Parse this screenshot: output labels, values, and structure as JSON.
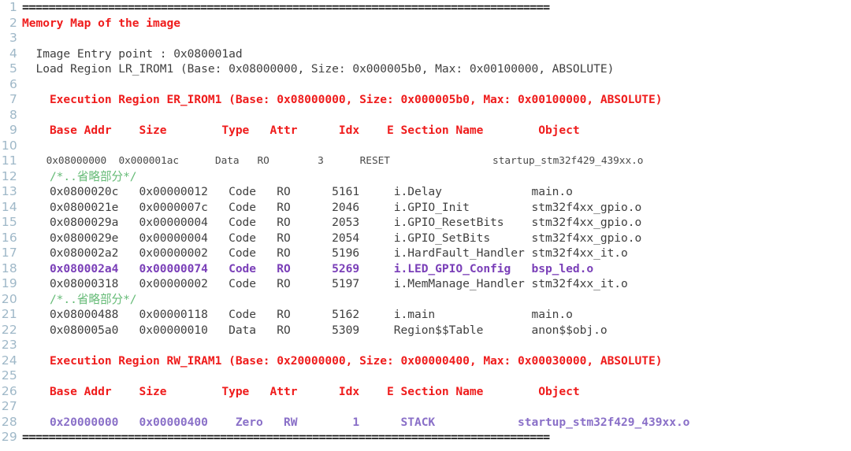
{
  "editor": {
    "title": "Memory Map of the image",
    "language": "armlink-map-listing",
    "gutter_color": "#9fb8c8",
    "colors": {
      "separator": "#1a1a1a",
      "heading_red": "#ef1c1c",
      "plain": "#404040",
      "comment_green": "#66bb77",
      "highlight_purple": "#7a3fb8",
      "highlight_purple_alt": "#8a70c8",
      "background": "#ffffff"
    },
    "first_line_number": 1,
    "last_line_number": 29,
    "total_lines": 29
  },
  "lines": [
    {
      "n": "1",
      "style": "c-sep",
      "text": "================================================================================"
    },
    {
      "n": "2",
      "style": "c-red",
      "text": "Memory Map of the image"
    },
    {
      "n": "3",
      "style": "c-plain",
      "text": ""
    },
    {
      "n": "4",
      "style": "c-plain",
      "text": "  Image Entry point : 0x080001ad"
    },
    {
      "n": "5",
      "style": "c-plain",
      "text": "  Load Region LR_IROM1 (Base: 0x08000000, Size: 0x000005b0, Max: 0x00100000, ABSOLUTE)"
    },
    {
      "n": "6",
      "style": "c-plain",
      "text": ""
    },
    {
      "n": "7",
      "style": "c-red",
      "text": "    Execution Region ER_IROM1 (Base: 0x08000000, Size: 0x000005b0, Max: 0x00100000, ABSOLUTE)"
    },
    {
      "n": "8",
      "style": "c-plain",
      "text": ""
    },
    {
      "n": "9",
      "style": "c-red",
      "text": "    Base Addr    Size        Type   Attr      Idx    E Section Name        Object"
    },
    {
      "n": "10",
      "style": "c-plain",
      "text": ""
    },
    {
      "n": "11",
      "style": "c-small",
      "text": "    0x08000000  0x000001ac      Data   RO        3      RESET                 startup_stm32f429_439xx.o"
    },
    {
      "n": "12",
      "style": "c-green",
      "text": "    /*..省略部分*/"
    },
    {
      "n": "13",
      "style": "c-plain",
      "text": "    0x0800020c   0x00000012   Code   RO      5161     i.Delay             main.o"
    },
    {
      "n": "14",
      "style": "c-plain",
      "text": "    0x0800021e   0x0000007c   Code   RO      2046     i.GPIO_Init         stm32f4xx_gpio.o"
    },
    {
      "n": "15",
      "style": "c-plain",
      "text": "    0x0800029a   0x00000004   Code   RO      2053     i.GPIO_ResetBits    stm32f4xx_gpio.o"
    },
    {
      "n": "16",
      "style": "c-plain",
      "text": "    0x0800029e   0x00000004   Code   RO      2054     i.GPIO_SetBits      stm32f4xx_gpio.o"
    },
    {
      "n": "17",
      "style": "c-plain",
      "text": "    0x080002a2   0x00000002   Code   RO      5196     i.HardFault_Handler stm32f4xx_it.o"
    },
    {
      "n": "18",
      "style": "c-purple",
      "text": "    0x080002a4   0x00000074   Code   RO      5269     i.LED_GPIO_Config   bsp_led.o"
    },
    {
      "n": "19",
      "style": "c-plain",
      "text": "    0x08000318   0x00000002   Code   RO      5197     i.MemManage_Handler stm32f4xx_it.o"
    },
    {
      "n": "20",
      "style": "c-green",
      "text": "    /*..省略部分*/"
    },
    {
      "n": "21",
      "style": "c-plain",
      "text": "    0x08000488   0x00000118   Code   RO      5162     i.main              main.o"
    },
    {
      "n": "22",
      "style": "c-plain",
      "text": "    0x080005a0   0x00000010   Data   RO      5309     Region$$Table       anon$$obj.o"
    },
    {
      "n": "23",
      "style": "c-plain",
      "text": ""
    },
    {
      "n": "24",
      "style": "c-red",
      "text": "    Execution Region RW_IRAM1 (Base: 0x20000000, Size: 0x00000400, Max: 0x00030000, ABSOLUTE)"
    },
    {
      "n": "25",
      "style": "c-plain",
      "text": ""
    },
    {
      "n": "26",
      "style": "c-red",
      "text": "    Base Addr    Size        Type   Attr      Idx    E Section Name        Object"
    },
    {
      "n": "27",
      "style": "c-plain",
      "text": ""
    },
    {
      "n": "28",
      "style": "c-purple2",
      "text": "    0x20000000   0x00000400    Zero   RW        1      STACK            startup_stm32f429_439xx.o"
    },
    {
      "n": "29",
      "style": "c-sep",
      "text": "================================================================================"
    }
  ],
  "memory_map": {
    "image_entry_point": "0x080001ad",
    "load_region": {
      "name": "LR_IROM1",
      "base": "0x08000000",
      "size": "0x000005b0",
      "max": "0x00100000",
      "attr": "ABSOLUTE"
    },
    "execution_regions": [
      {
        "name": "ER_IROM1",
        "base": "0x08000000",
        "size": "0x000005b0",
        "max": "0x00100000",
        "attr": "ABSOLUTE",
        "columns": [
          "Base Addr",
          "Size",
          "Type",
          "Attr",
          "Idx",
          "E Section Name",
          "Object"
        ],
        "rows": [
          {
            "base_addr": "0x08000000",
            "size": "0x000001ac",
            "type": "Data",
            "attr": "RO",
            "idx": "3",
            "section": "RESET",
            "object": "startup_stm32f429_439xx.o",
            "highlight": "none"
          },
          {
            "base_addr": "0x0800020c",
            "size": "0x00000012",
            "type": "Code",
            "attr": "RO",
            "idx": "5161",
            "section": "i.Delay",
            "object": "main.o",
            "highlight": "none"
          },
          {
            "base_addr": "0x0800021e",
            "size": "0x0000007c",
            "type": "Code",
            "attr": "RO",
            "idx": "2046",
            "section": "i.GPIO_Init",
            "object": "stm32f4xx_gpio.o",
            "highlight": "none"
          },
          {
            "base_addr": "0x0800029a",
            "size": "0x00000004",
            "type": "Code",
            "attr": "RO",
            "idx": "2053",
            "section": "i.GPIO_ResetBits",
            "object": "stm32f4xx_gpio.o",
            "highlight": "none"
          },
          {
            "base_addr": "0x0800029e",
            "size": "0x00000004",
            "type": "Code",
            "attr": "RO",
            "idx": "2054",
            "section": "i.GPIO_SetBits",
            "object": "stm32f4xx_gpio.o",
            "highlight": "none"
          },
          {
            "base_addr": "0x080002a2",
            "size": "0x00000002",
            "type": "Code",
            "attr": "RO",
            "idx": "5196",
            "section": "i.HardFault_Handler",
            "object": "stm32f4xx_it.o",
            "highlight": "none"
          },
          {
            "base_addr": "0x080002a4",
            "size": "0x00000074",
            "type": "Code",
            "attr": "RO",
            "idx": "5269",
            "section": "i.LED_GPIO_Config",
            "object": "bsp_led.o",
            "highlight": "purple"
          },
          {
            "base_addr": "0x08000318",
            "size": "0x00000002",
            "type": "Code",
            "attr": "RO",
            "idx": "5197",
            "section": "i.MemManage_Handler",
            "object": "stm32f4xx_it.o",
            "highlight": "none"
          },
          {
            "base_addr": "0x08000488",
            "size": "0x00000118",
            "type": "Code",
            "attr": "RO",
            "idx": "5162",
            "section": "i.main",
            "object": "main.o",
            "highlight": "none"
          },
          {
            "base_addr": "0x080005a0",
            "size": "0x00000010",
            "type": "Data",
            "attr": "RO",
            "idx": "5309",
            "section": "Region$$Table",
            "object": "anon$$obj.o",
            "highlight": "none"
          }
        ]
      },
      {
        "name": "RW_IRAM1",
        "base": "0x20000000",
        "size": "0x00000400",
        "max": "0x00030000",
        "attr": "ABSOLUTE",
        "columns": [
          "Base Addr",
          "Size",
          "Type",
          "Attr",
          "Idx",
          "E Section Name",
          "Object"
        ],
        "rows": [
          {
            "base_addr": "0x20000000",
            "size": "0x00000400",
            "type": "Zero",
            "attr": "RW",
            "idx": "1",
            "section": "STACK",
            "object": "startup_stm32f429_439xx.o",
            "highlight": "purple"
          }
        ]
      }
    ],
    "elided_marker": "/*..省略部分*/"
  }
}
